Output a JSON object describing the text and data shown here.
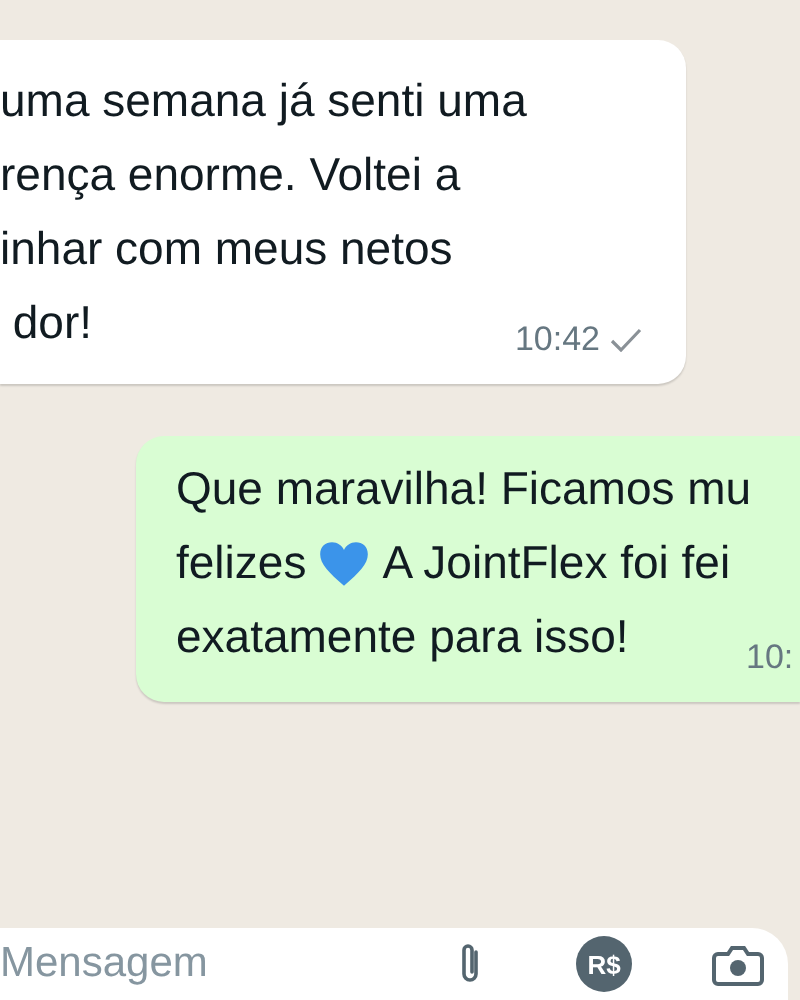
{
  "messages": [
    {
      "kind": "incoming",
      "lines": [
        [
          {
            "kind": "text",
            "text": "uma semana já senti uma"
          }
        ],
        [
          {
            "kind": "text",
            "text": "rença enorme. Voltei a"
          }
        ],
        [
          {
            "kind": "text",
            "text": "inhar com meus netos"
          }
        ],
        [
          {
            "kind": "text",
            "text": " dor!"
          }
        ]
      ],
      "time": "10:42",
      "delivered": true
    },
    {
      "kind": "outgoing",
      "lines": [
        [
          {
            "kind": "text",
            "text": "Que maravilha! Ficamos mu"
          }
        ],
        [
          {
            "kind": "text",
            "text": "felizes"
          },
          {
            "kind": "heart"
          },
          {
            "kind": "text",
            "text": "A JointFlex foi fei"
          }
        ],
        [
          {
            "kind": "text",
            "text": "exatamente para isso!"
          }
        ]
      ],
      "time": "10:"
    }
  ],
  "composer": {
    "placeholder": "Mensagem",
    "payment_label": "R$"
  }
}
